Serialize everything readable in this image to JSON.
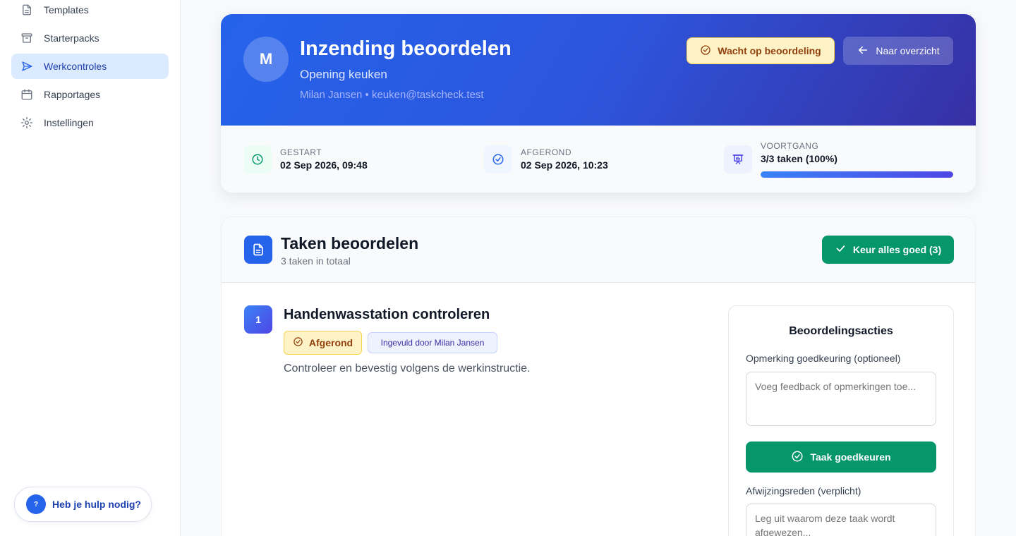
{
  "sidebar": {
    "items": [
      {
        "label": "Templates",
        "icon": "document-icon"
      },
      {
        "label": "Starterpacks",
        "icon": "archive-icon"
      },
      {
        "label": "Werkcontroles",
        "icon": "send-icon",
        "active": true
      },
      {
        "label": "Rapportages",
        "icon": "calendar-icon"
      },
      {
        "label": "Instellingen",
        "icon": "gear-icon"
      }
    ],
    "help": {
      "icon_text": "?",
      "label": "Heb je hulp nodig?"
    }
  },
  "header": {
    "avatar": "M",
    "title": "Inzending beoordelen",
    "subtitle": "Opening keuken",
    "meta": "Milan Jansen • keuken@taskcheck.test",
    "status_badge": "Wacht op beoordeling",
    "back_button": "Naar overzicht"
  },
  "stats": {
    "started": {
      "label": "GESTART",
      "value": "02 Sep 2026, 09:48"
    },
    "finished": {
      "label": "AFGEROND",
      "value": "02 Sep 2026, 10:23"
    },
    "progress": {
      "label": "VOORTGANG",
      "value": "3/3 taken (100%)",
      "fraction": 1.0
    }
  },
  "tasks": {
    "title": "Taken beoordelen",
    "count": "3 taken in totaal",
    "approve_all": "Keur alles goed (3)",
    "items": [
      {
        "number": "1",
        "title": "Handenwasstation controleren",
        "status": "Afgerond",
        "filled_by": "Ingevuld door Milan Jansen",
        "description": "Controleer en bevestig volgens de werkinstructie."
      }
    ]
  },
  "review": {
    "title": "Beoordelingsacties",
    "approve_comment_label": "Opmerking goedkeuring (optioneel)",
    "approve_comment_placeholder": "Voeg feedback of opmerkingen toe...",
    "approve_button": "Taak goedkeuren",
    "reject_reason_label": "Afwijzingsreden (verplicht)",
    "reject_reason_placeholder": "Leg uit waarom deze taak wordt afgewezen..."
  },
  "colors": {
    "primary": "#2563eb",
    "success": "#059669",
    "warning_bg": "#fef3c7",
    "warning_text": "#92400e"
  }
}
